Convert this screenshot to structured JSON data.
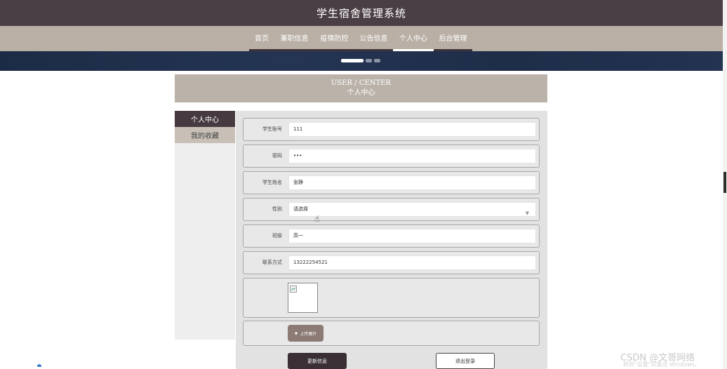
{
  "app": {
    "title": "学生宿舍管理系统"
  },
  "nav": {
    "items": [
      {
        "label": "首页"
      },
      {
        "label": "兼职信息"
      },
      {
        "label": "疫情防控"
      },
      {
        "label": "公告信息"
      },
      {
        "label": "个人中心"
      },
      {
        "label": "后台管理"
      }
    ],
    "active_index": 4
  },
  "header": {
    "en": "USER / CENTER",
    "cn": "个人中心"
  },
  "sidebar": {
    "items": [
      {
        "label": "个人中心"
      },
      {
        "label": "我的收藏"
      }
    ]
  },
  "form": {
    "account": {
      "label": "学生账号",
      "value": "111"
    },
    "password": {
      "label": "密码",
      "value": "•••"
    },
    "name": {
      "label": "学生姓名",
      "value": "张静"
    },
    "gender": {
      "label": "性别",
      "value": "请选择"
    },
    "class": {
      "label": "班级",
      "value": "高一"
    },
    "phone": {
      "label": "联系方式",
      "value": "13222254521"
    },
    "upload_label": "上传图片",
    "update_button": "更新信息",
    "logout_button": "退出登录"
  },
  "watermark": {
    "text": "CSDN @文哥网络",
    "windows": "转到\"设置\"以激活 Windows。"
  }
}
